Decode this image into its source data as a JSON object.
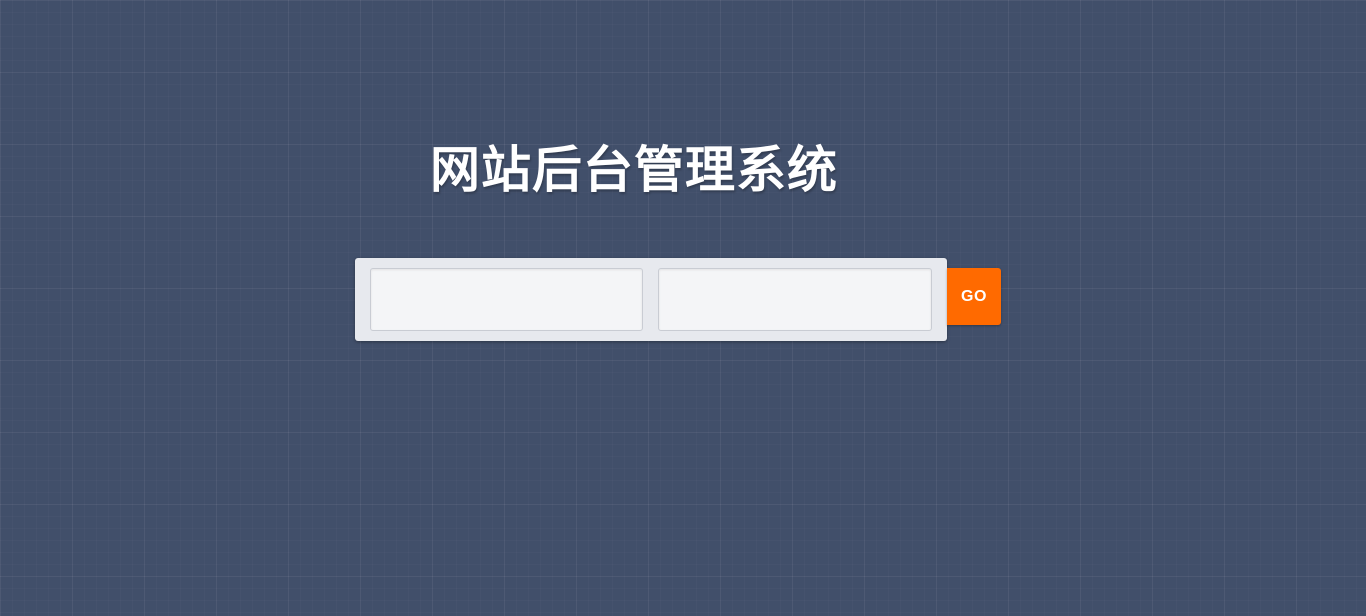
{
  "page": {
    "title": "网站后台管理系统"
  },
  "login": {
    "username": {
      "value": "",
      "placeholder": ""
    },
    "password": {
      "value": "",
      "placeholder": ""
    },
    "submit_label": "GO"
  },
  "colors": {
    "background": "#414f6a",
    "panel": "#e7e9ee",
    "field": "#f4f5f7",
    "accent": "#ff6a00",
    "title_text": "#ffffff"
  }
}
